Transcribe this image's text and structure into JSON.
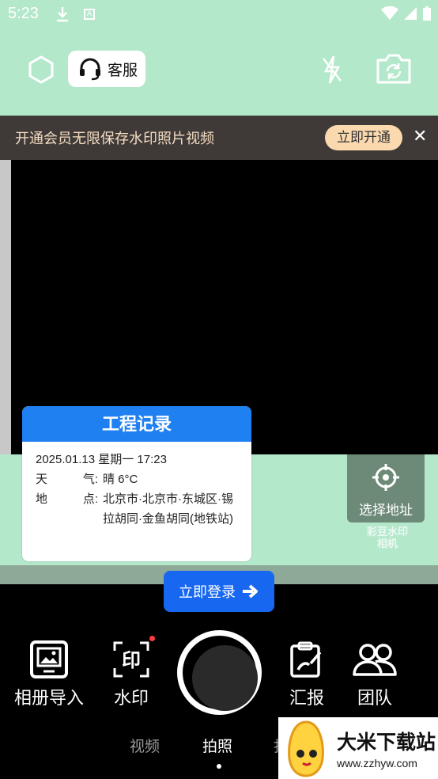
{
  "status_bar": {
    "time": "5:23",
    "a_icon": "A"
  },
  "top_bar": {
    "customer_service": "客服"
  },
  "banner": {
    "text": "开通会员无限保存水印照片视频",
    "button": "立即开通",
    "close": "✕"
  },
  "watermark": {
    "title": "工程记录",
    "datetime": "2025.01.13 星期一 17:23",
    "weather_k1": "天",
    "weather_k2": "气:",
    "weather_v": "晴 6°C",
    "place_k1": "地",
    "place_k2": "点:",
    "place_v": "北京市·北京市·东城区·锡拉胡同·金鱼胡同(地铁站)"
  },
  "select_address": "选择地址",
  "logo_watermark": {
    "line1": "彩豆水印",
    "line2": "相机"
  },
  "login_button": "立即登录",
  "tools": {
    "album": "相册导入",
    "watermark": "水印",
    "report": "汇报",
    "team": "团队"
  },
  "modes": {
    "video": "视频",
    "photo": "拍照",
    "other": "打"
  },
  "site_badge": {
    "name": "大米下载站",
    "url": "www.zzhyw.com"
  },
  "colors": {
    "primary": "#1f80f2",
    "login": "#1867f0",
    "bg_green": "#b4e8cb",
    "banner": "#3f3a38"
  }
}
